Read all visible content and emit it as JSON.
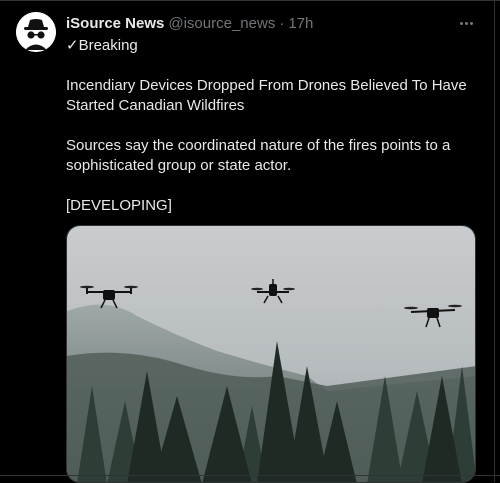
{
  "tweet": {
    "display_name": "iSource News",
    "handle": "@isource_news",
    "separator": "·",
    "time": "17h",
    "line_breaking": "✓Breaking",
    "headline": "Incendiary Devices Dropped From Drones Believed To Have Started Canadian Wildfires",
    "body": "Sources say the coordinated nature of the fires points to a sophisticated group or state actor.",
    "status": "[DEVELOPING]",
    "avatar_icon": "incognito-spy-icon",
    "more_icon": "more-options-icon",
    "media_description_icon": "drones-over-forest-image"
  },
  "colors": {
    "background": "#000000",
    "text": "#e7e9ea",
    "muted": "#71767b",
    "border": "#2f3336"
  }
}
